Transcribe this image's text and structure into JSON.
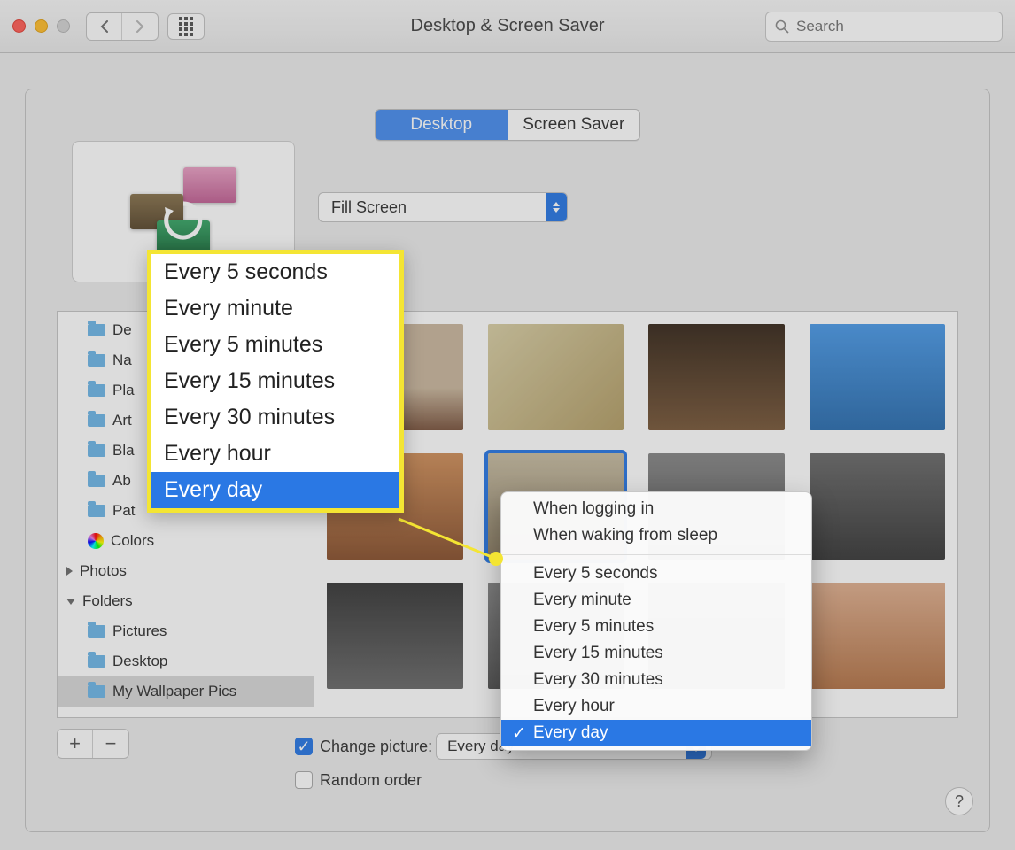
{
  "window": {
    "title": "Desktop & Screen Saver"
  },
  "search": {
    "placeholder": "Search"
  },
  "tabs": {
    "desktop": "Desktop",
    "screensaver": "Screen Saver"
  },
  "fill_mode": {
    "label": "Fill Screen"
  },
  "sidebar": {
    "items": [
      {
        "label": "De"
      },
      {
        "label": "Na"
      },
      {
        "label": "Pla"
      },
      {
        "label": "Art"
      },
      {
        "label": "Bla"
      },
      {
        "label": "Ab"
      },
      {
        "label": "Pat"
      }
    ],
    "colors": "Colors",
    "photos": "Photos",
    "folders": "Folders",
    "subfolders": [
      {
        "label": "Pictures"
      },
      {
        "label": "Desktop"
      },
      {
        "label": "My Wallpaper Pics"
      }
    ]
  },
  "controls": {
    "change_picture": "Change picture:",
    "random_order": "Random order",
    "change_value": "Every day"
  },
  "menu": {
    "top": [
      "When logging in",
      "When waking from sleep"
    ],
    "intervals": [
      "Every 5 seconds",
      "Every minute",
      "Every 5 minutes",
      "Every 15 minutes",
      "Every 30 minutes",
      "Every hour",
      "Every day"
    ],
    "selected": "Every day"
  },
  "help": "?"
}
